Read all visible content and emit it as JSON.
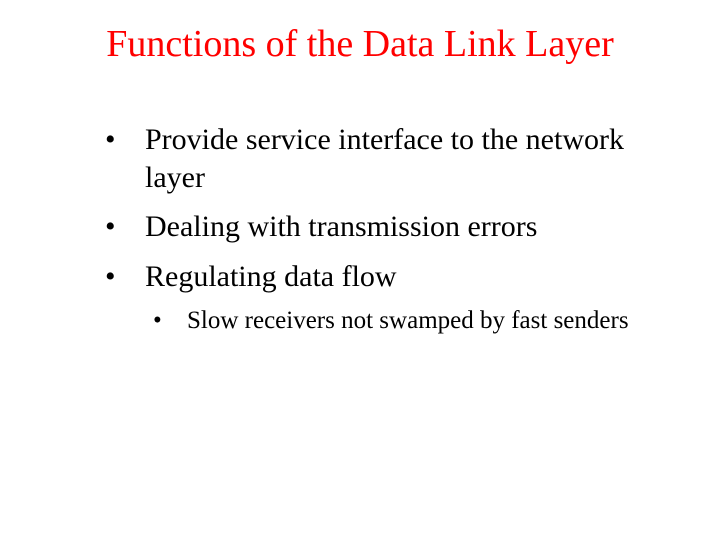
{
  "title": "Functions of the Data Link Layer",
  "bullets": [
    {
      "text": "Provide service interface to the network layer"
    },
    {
      "text": "Dealing with transmission errors"
    },
    {
      "text": "Regulating data flow",
      "sub": [
        "Slow receivers not swamped by fast senders"
      ]
    }
  ]
}
